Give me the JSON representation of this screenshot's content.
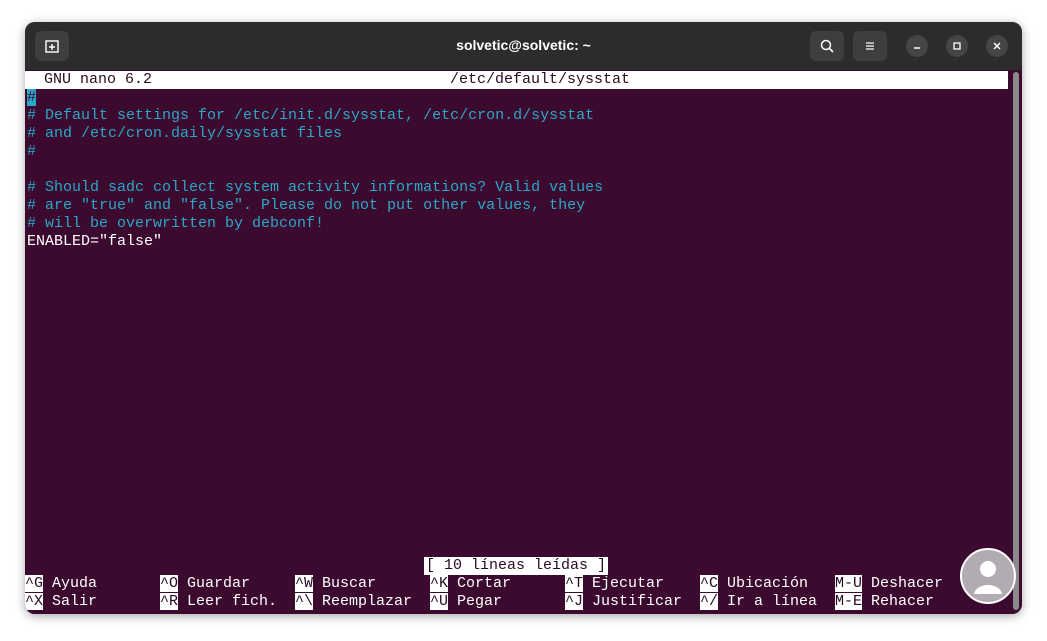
{
  "window": {
    "title": "solvetic@solvetic: ~"
  },
  "nano": {
    "version": "GNU nano 6.2",
    "filename": "/etc/default/sysstat",
    "lines": [
      {
        "text": "#",
        "type": "comment",
        "cursor": true
      },
      {
        "text": "# Default settings for /etc/init.d/sysstat, /etc/cron.d/sysstat",
        "type": "comment"
      },
      {
        "text": "# and /etc/cron.daily/sysstat files",
        "type": "comment"
      },
      {
        "text": "#",
        "type": "comment"
      },
      {
        "text": "",
        "type": "blank"
      },
      {
        "text": "# Should sadc collect system activity informations? Valid values",
        "type": "comment"
      },
      {
        "text": "# are \"true\" and \"false\". Please do not put other values, they",
        "type": "comment"
      },
      {
        "text": "# will be overwritten by debconf!",
        "type": "comment"
      },
      {
        "text": "ENABLED=\"false\"",
        "type": "code"
      }
    ],
    "status": "[ 10 líneas leídas ]",
    "shortcuts_row1": [
      {
        "key": "^G",
        "label": "Ayuda"
      },
      {
        "key": "^O",
        "label": "Guardar"
      },
      {
        "key": "^W",
        "label": "Buscar"
      },
      {
        "key": "^K",
        "label": "Cortar"
      },
      {
        "key": "^T",
        "label": "Ejecutar"
      },
      {
        "key": "^C",
        "label": "Ubicación"
      },
      {
        "key": "M-U",
        "label": "Deshacer"
      }
    ],
    "shortcuts_row2": [
      {
        "key": "^X",
        "label": "Salir"
      },
      {
        "key": "^R",
        "label": "Leer fich."
      },
      {
        "key": "^\\",
        "label": "Reemplazar"
      },
      {
        "key": "^U",
        "label": "Pegar"
      },
      {
        "key": "^J",
        "label": "Justificar"
      },
      {
        "key": "^/",
        "label": "Ir a línea"
      },
      {
        "key": "M-E",
        "label": "Rehacer"
      }
    ]
  },
  "colors": {
    "terminal_bg": "#3b0a2e",
    "comment": "#2aa8c9",
    "titlebar": "#2c2c2c"
  },
  "icons": {
    "new_tab": "new-tab-icon",
    "search": "search-icon",
    "menu": "hamburger-menu-icon",
    "minimize": "minimize-icon",
    "maximize": "maximize-icon",
    "close": "close-icon"
  }
}
